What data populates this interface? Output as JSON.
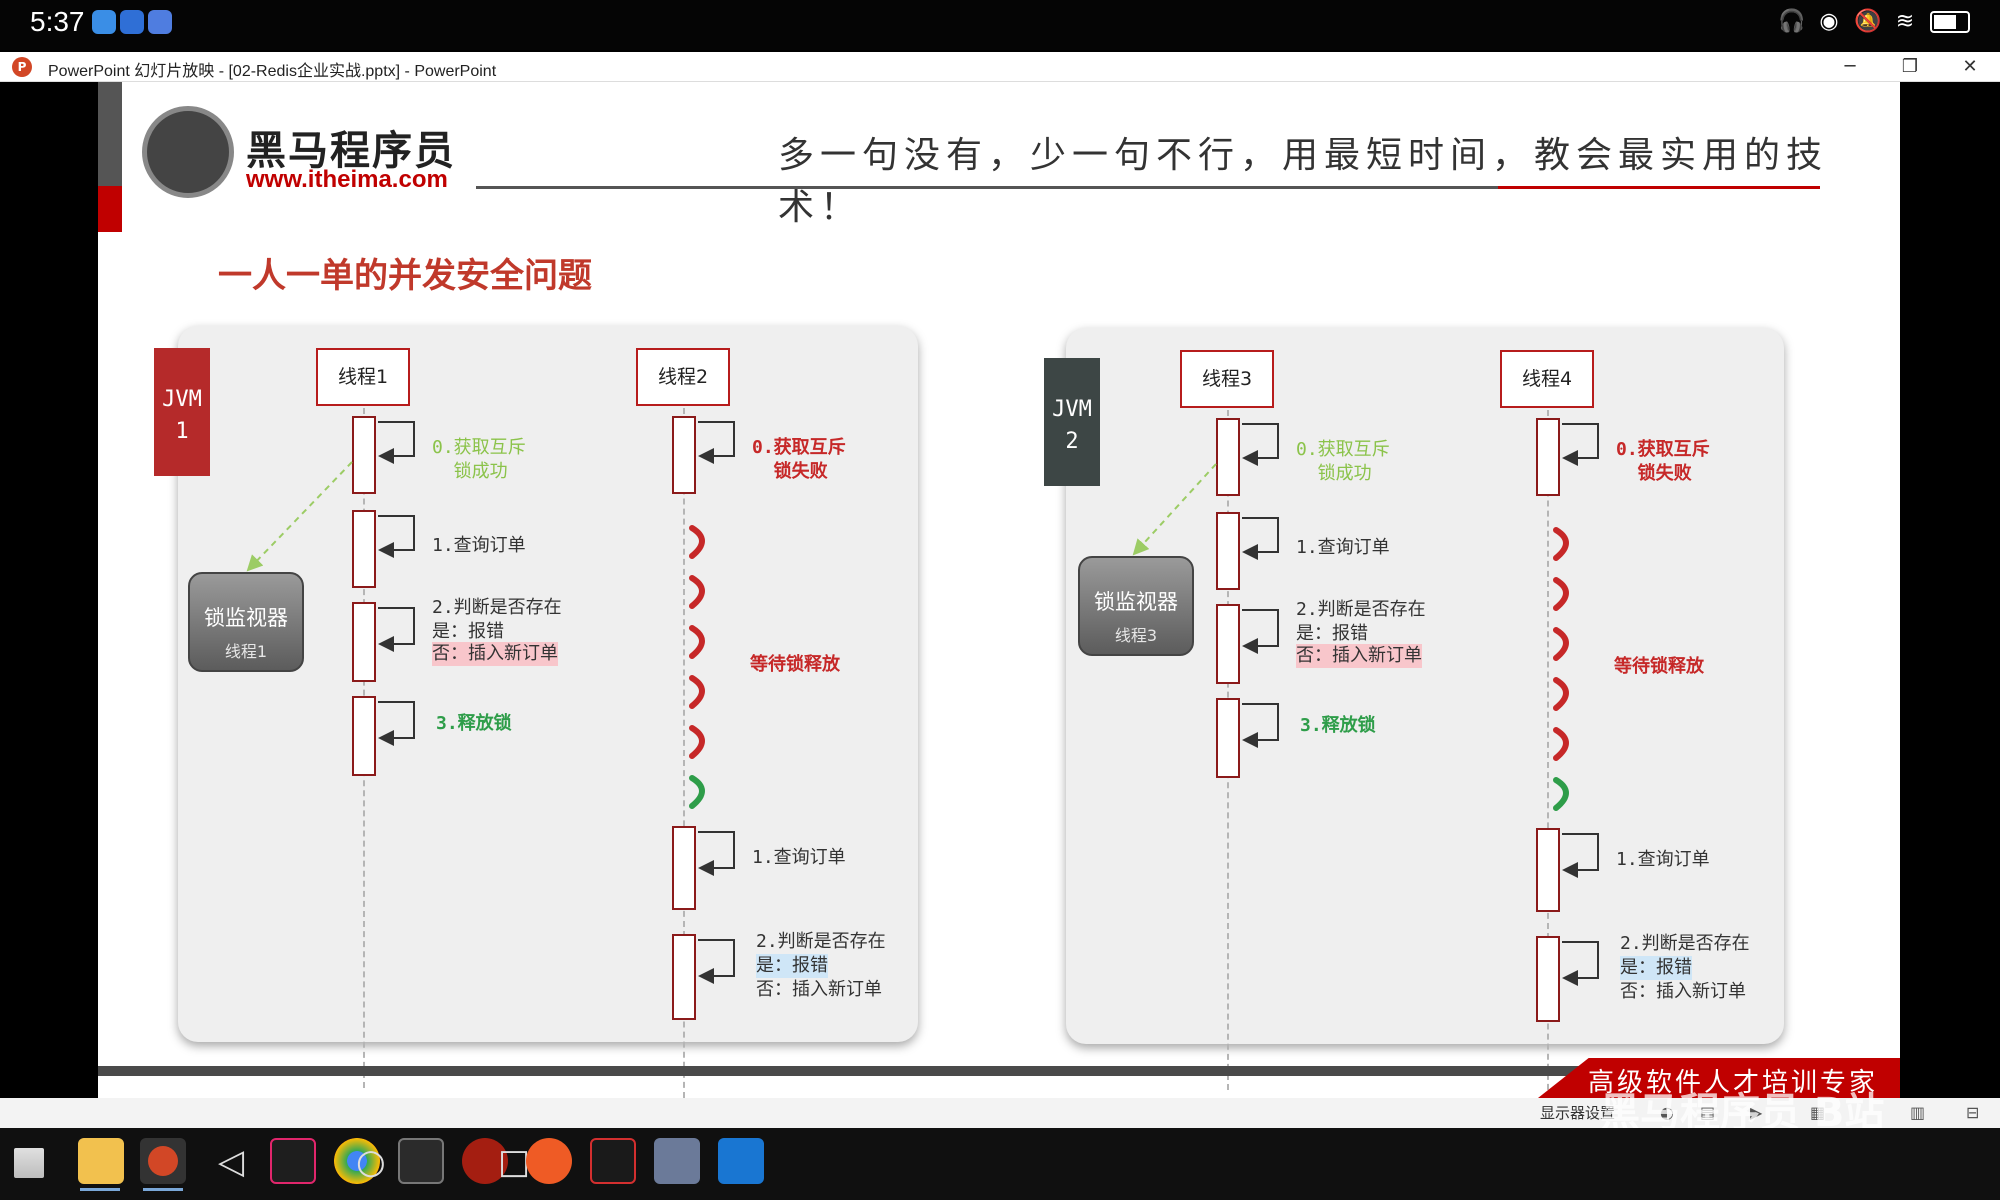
{
  "status_bar": {
    "time": "5:37",
    "icons": [
      "headphones-icon",
      "eye-icon",
      "mute-icon",
      "wifi-icon",
      "battery-icon"
    ]
  },
  "window": {
    "title": "PowerPoint 幻灯片放映 - [02-Redis企业实战.pptx] - PowerPoint",
    "minimize": "─",
    "restore": "❐",
    "close": "✕"
  },
  "slide": {
    "brand_name": "黑马程序员",
    "brand_url": "www.itheima.com",
    "slogan": "多一句没有，少一句不行，用最短时间，教会最实用的技术！",
    "heading": "一人一单的并发安全问题",
    "footer": "高级软件人才培训专家",
    "accent_red": "#c00000",
    "panels": [
      {
        "jvm": "JVM\n1",
        "jvm_color": "#b52a2a",
        "monitor": {
          "title": "锁监视器",
          "owner": "线程1"
        },
        "thread_a": {
          "name": "线程1",
          "step0": "0.获取互斥\n  锁成功",
          "step1": "1.查询订单",
          "step2_line1": "2.判断是否存在",
          "step2_line2": "是：报错",
          "step2_line3": "否：插入新订单",
          "step3": "3.释放锁"
        },
        "thread_b": {
          "name": "线程2",
          "step0": "0.获取互斥\n  锁失败",
          "wait": "等待锁释放",
          "step1": "1.查询订单",
          "step2_line1": "2.判断是否存在",
          "step2_line2": "是：报错",
          "step2_line3": "否：插入新订单"
        }
      },
      {
        "jvm": "JVM\n2",
        "jvm_color": "#3d4645",
        "monitor": {
          "title": "锁监视器",
          "owner": "线程3"
        },
        "thread_a": {
          "name": "线程3",
          "step0": "0.获取互斥\n  锁成功",
          "step1": "1.查询订单",
          "step2_line1": "2.判断是否存在",
          "step2_line2": "是：报错",
          "step2_line3": "否：插入新订单",
          "step3": "3.释放锁"
        },
        "thread_b": {
          "name": "线程4",
          "step0": "0.获取互斥\n  锁失败",
          "wait": "等待锁释放",
          "step1": "1.查询订单",
          "step2_line1": "2.判断是否存在",
          "step2_line2": "是：报错",
          "step2_line3": "否：插入新订单"
        }
      }
    ]
  },
  "slideshow_controls": {
    "display_settings": "显示器设置"
  },
  "watermark": "黑马程序员 B站",
  "taskbar": {
    "apps": [
      "windows-start-icon",
      "file-explorer-icon",
      "powerpoint-icon",
      "back-nav-icon",
      "intellij-icon",
      "chrome-icon",
      "home-nav-icon",
      "terminal-icon",
      "redis-icon",
      "recent-nav-icon",
      "postman-icon",
      "pen-icon",
      "calculator-icon",
      "vscode-icon"
    ]
  }
}
